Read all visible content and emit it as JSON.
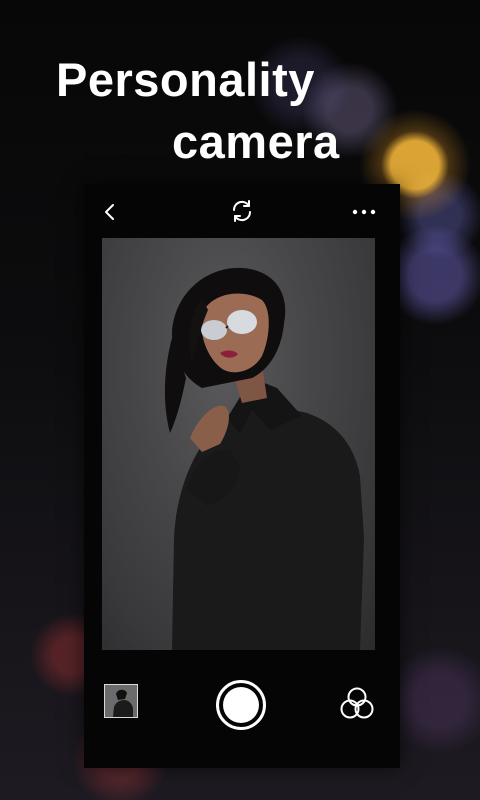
{
  "promo": {
    "headline_line1": "Personality",
    "headline_line2": "camera"
  },
  "camera": {
    "topbar": {
      "back_icon": "chevron-left-icon",
      "switch_icon": "camera-switch-icon",
      "more_icon": "more-horizontal-icon"
    },
    "bottombar": {
      "gallery_icon": "gallery-thumbnail",
      "shutter_icon": "shutter-button-icon",
      "filters_icon": "filters-icon"
    }
  },
  "colors": {
    "text": "#ffffff",
    "phone_bg": "#050505"
  }
}
